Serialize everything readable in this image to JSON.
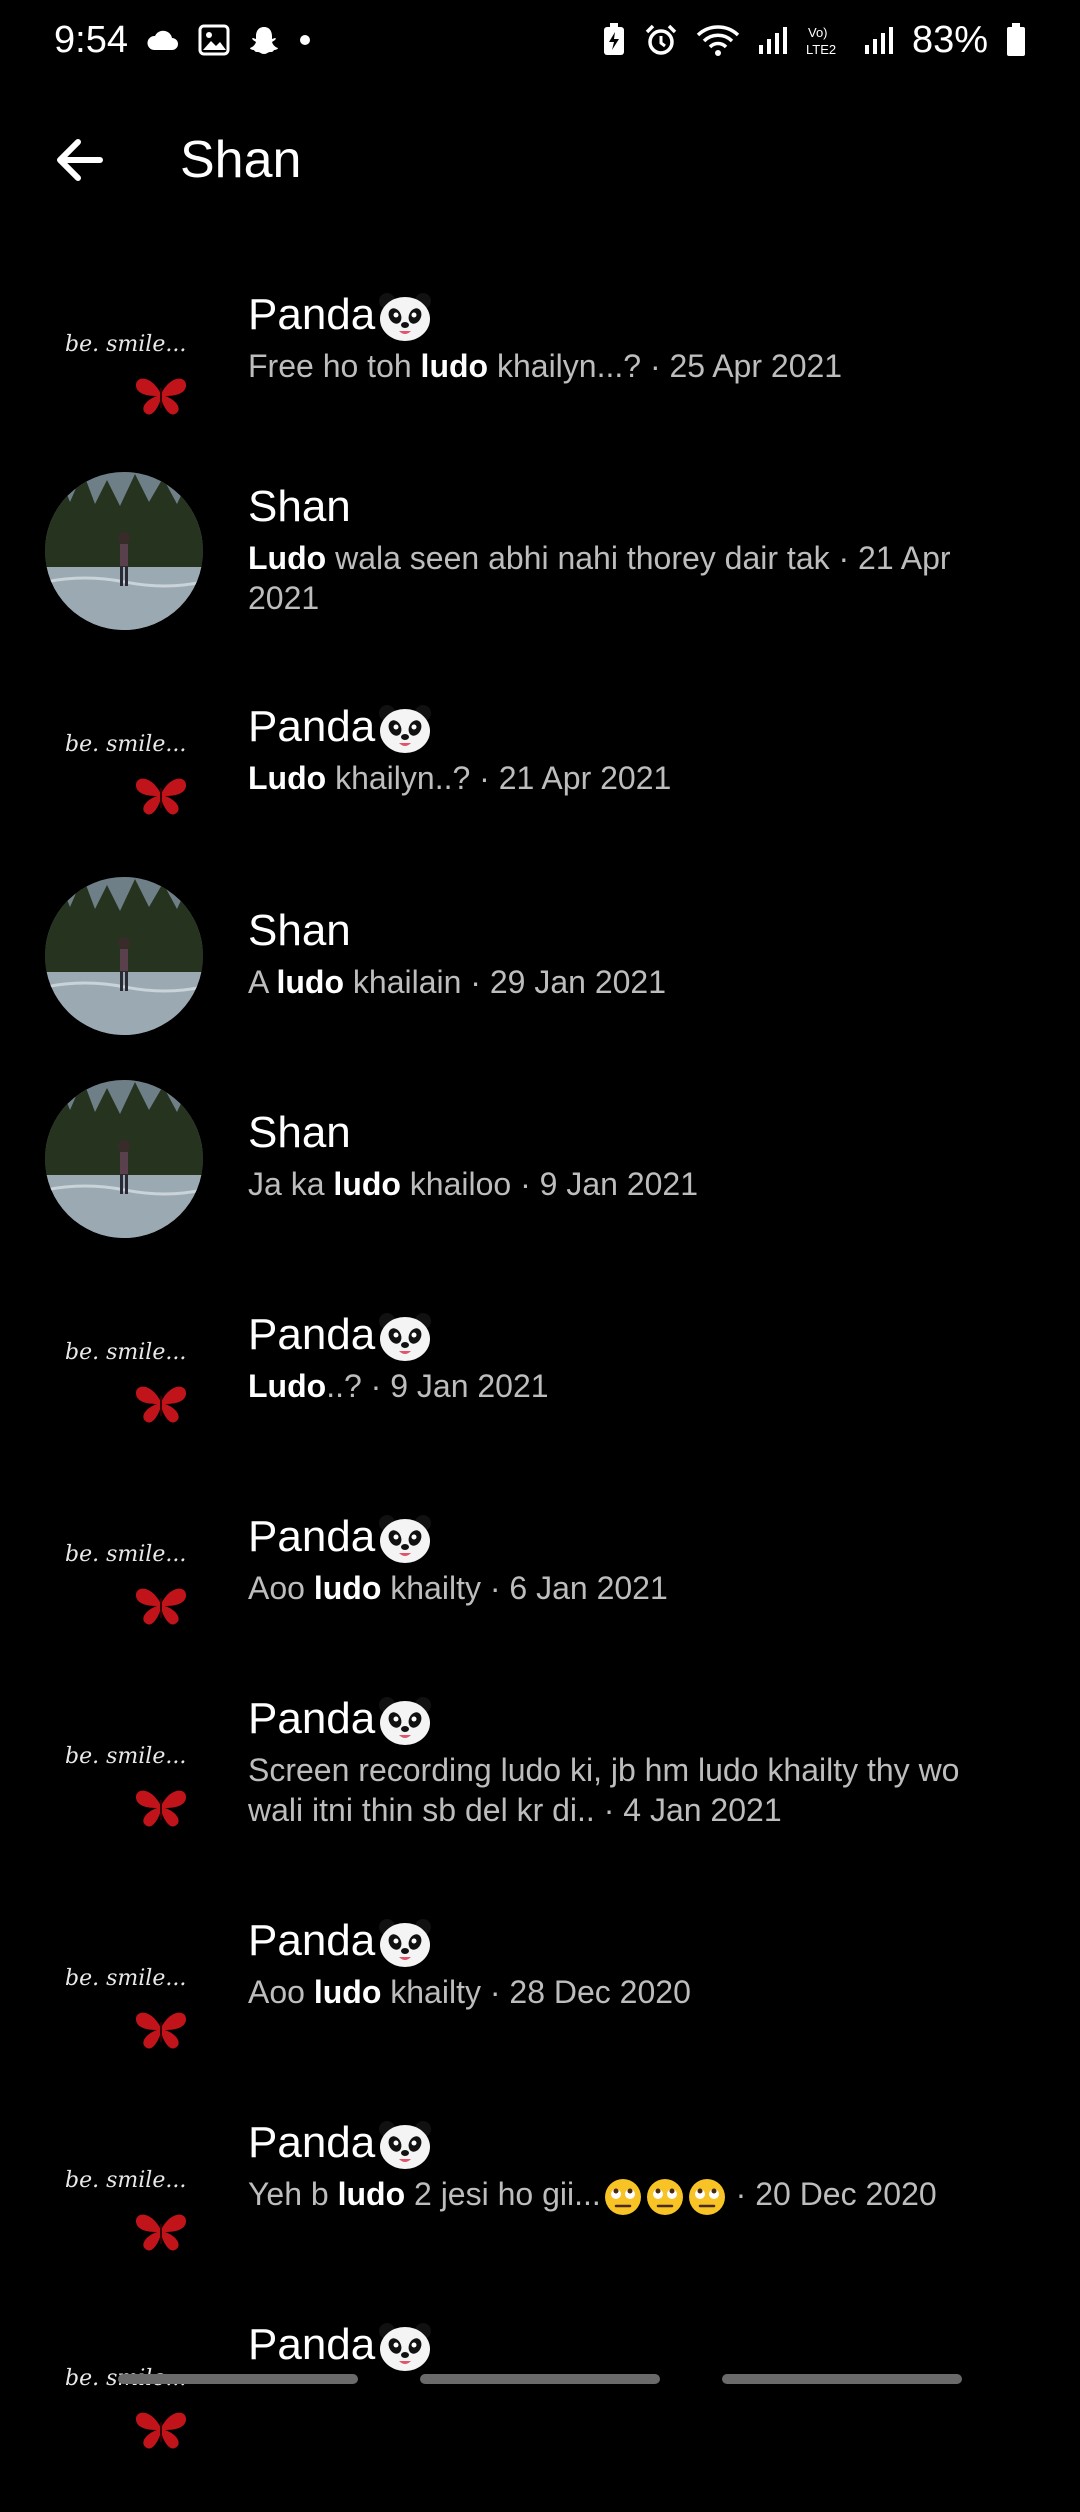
{
  "status_bar": {
    "time": "9:54",
    "battery": "83%",
    "left_icons": [
      "cloud-icon",
      "gallery-icon",
      "snapchat-icon",
      "dot-icon"
    ],
    "right_icons": [
      "battery-saver-icon",
      "alarm-icon",
      "wifi-icon",
      "signal-icon",
      "volte-icon",
      "signal2-icon",
      "battery-icon"
    ]
  },
  "header": {
    "title": "Shan",
    "back_icon": "arrow-left-icon"
  },
  "results": [
    {
      "sender": "Panda",
      "avatar": "be-smile",
      "before": "Free ho toh ",
      "highlight": "ludo",
      "after": " khailyn...?",
      "date": " · 25 Apr 2021"
    },
    {
      "sender": "Shan",
      "avatar": "photo",
      "before": "",
      "highlight": "Ludo",
      "after": " wala seen abhi nahi thorey dair tak",
      "date": " · 21 Apr 2021"
    },
    {
      "sender": "Panda",
      "avatar": "be-smile",
      "before": "",
      "highlight": "Ludo",
      "after": " khailyn..?",
      "date": " · 21 Apr 2021"
    },
    {
      "sender": "Shan",
      "avatar": "photo",
      "before": "A ",
      "highlight": "ludo",
      "after": " khailain",
      "date": " · 29 Jan 2021"
    },
    {
      "sender": "Shan",
      "avatar": "photo",
      "before": "Ja ka ",
      "highlight": "ludo",
      "after": " khailoo",
      "date": " · 9 Jan 2021"
    },
    {
      "sender": "Panda",
      "avatar": "be-smile",
      "before": "",
      "highlight": "Ludo",
      "after": "..?",
      "date": " · 9 Jan 2021"
    },
    {
      "sender": "Panda",
      "avatar": "be-smile",
      "before": "Aoo ",
      "highlight": "ludo",
      "after": " khailty",
      "date": " · 6 Jan 2021"
    },
    {
      "sender": "Panda",
      "avatar": "be-smile",
      "before": "Screen recording ludo ki, jb hm ludo khailty thy wo wali itni thin sb del kr di..",
      "highlight": "",
      "after": "",
      "date": " · 4 Jan 2021"
    },
    {
      "sender": "Panda",
      "avatar": "be-smile",
      "before": "Aoo ",
      "highlight": "ludo",
      "after": " khailty",
      "date": " · 28 Dec 2020"
    },
    {
      "sender": "Panda",
      "avatar": "be-smile",
      "before": "Yeh b ",
      "highlight": "ludo",
      "after": " 2 jesi ho gii...",
      "emoji": "🙄🙄🙄",
      "date": " · 20 Dec 2020"
    },
    {
      "sender": "Panda",
      "avatar": "be-smile",
      "before": "",
      "highlight": "",
      "after": "",
      "date": ""
    }
  ],
  "smile_caption": "be. smile...",
  "colors": {
    "background": "#000000",
    "text": "#ffffff",
    "secondary_text": "#bdbdbd",
    "butterfly": "#c0141a"
  }
}
